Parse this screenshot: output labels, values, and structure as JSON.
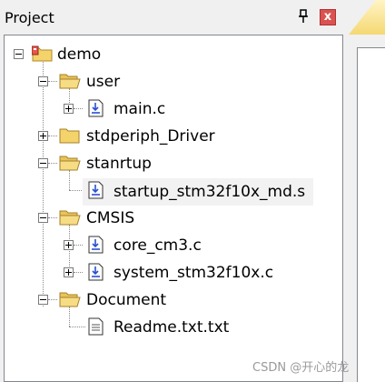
{
  "panel": {
    "title": "Project",
    "pin_glyph": "p",
    "close_glyph": "x"
  },
  "tree": {
    "root": "demo",
    "user": "user",
    "main_c": "main.c",
    "stdperiph": "stdperiph_Driver",
    "stanrtup": "stanrtup",
    "startup_file": "startup_stm32f10x_md.s",
    "cmsis": "CMSIS",
    "core_cm3": "core_cm3.c",
    "system_file": "system_stm32f10x.c",
    "document": "Document",
    "readme": "Readme.txt.txt"
  },
  "watermark": "CSDN @开心的龙",
  "icons": {
    "folder": "folder-icon",
    "project": "project-folder-icon",
    "source_file": "source-file-icon",
    "text_file": "text-file-icon"
  },
  "colors": {
    "close_button": "#d9534f",
    "folder": "#f5d36b",
    "tab_accent": "#f5d873"
  }
}
